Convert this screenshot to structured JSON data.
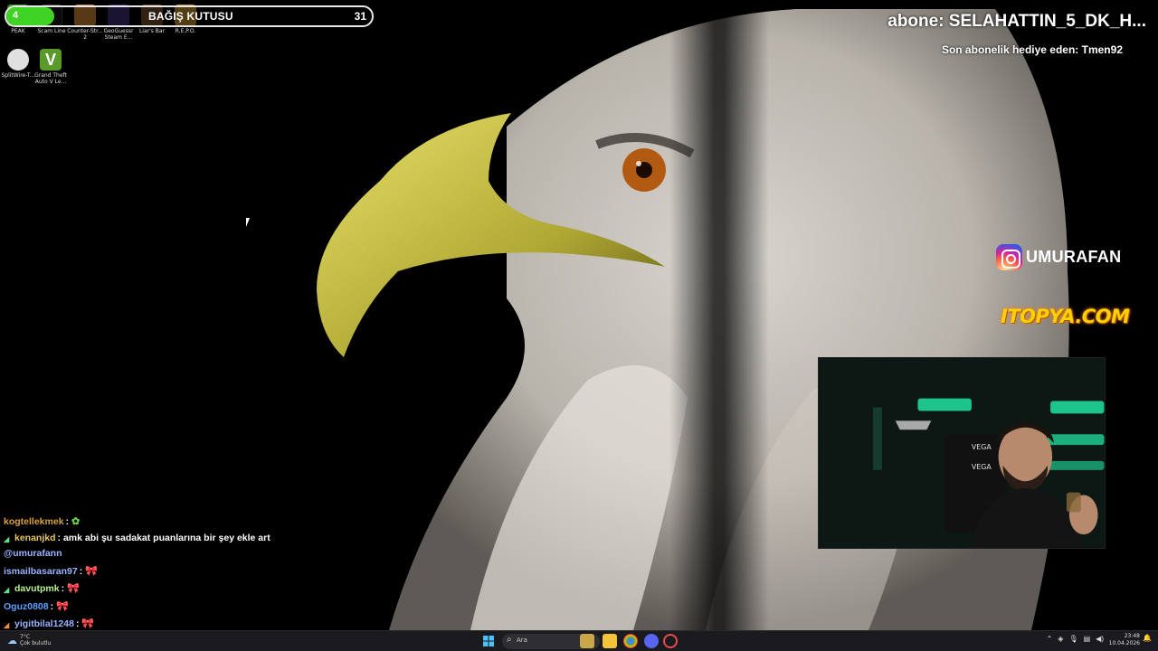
{
  "desktop": {
    "icons": [
      {
        "name": "peak-icon",
        "label": "PEAK",
        "color": "#3c9b2e"
      },
      {
        "name": "scam-line-icon",
        "label": "Scam Line",
        "color": "#1a1a1a"
      },
      {
        "name": "counter-strike-icon",
        "label": "Counter-Str... 2",
        "color": "#c08230"
      },
      {
        "name": "geoguessr-icon",
        "label": "GeoGuessr Steam E...",
        "color": "#3a2e70"
      },
      {
        "name": "liars-bar-icon",
        "label": "Liar's Bar",
        "color": "#6a4a2a"
      },
      {
        "name": "repo-icon",
        "label": "R.E.P.O.",
        "color": "#b88a2a"
      },
      {
        "name": "splitwire-icon",
        "label": "SplitWire-T...",
        "color": "#e0e0e0"
      },
      {
        "name": "gta-v-icon",
        "label": "Grand Theft Auto V Le...",
        "color": "#5a9a2a"
      }
    ]
  },
  "donation": {
    "left_count": "4",
    "title": "BAĞIŞ KUTUSU",
    "count": "31",
    "progress_fraction": 0.13,
    "fill_color": "#3fd423"
  },
  "overlay": {
    "subscriber_ticker": "abone: SELAHATTIN_5_DK_H...",
    "gift_text": "Son abonelik hediye eden: Tmen92",
    "instagram_handle": "UMURAFAN",
    "sponsor": "ITOPYA.COM"
  },
  "chat": {
    "messages": [
      {
        "user": "kogtellekmek",
        "user_color": "#d8a040",
        "text": ": ",
        "emote": "✿"
      },
      {
        "user": "kenanjkd",
        "user_color": "#e5c66a",
        "text": ": amk abi şu sadakat puanlarına bir şey ekle art",
        "emote": ""
      },
      {
        "user": "@umurafann",
        "user_color": "#9ab3ff",
        "text": "",
        "emote": ""
      },
      {
        "user": "ismailbasaran97",
        "user_color": "#9ab3ff",
        "text": ":",
        "emote": "🎀"
      },
      {
        "user": "davutpmk",
        "user_color": "#b6f08a",
        "text": ":",
        "emote": "🎀"
      },
      {
        "user": "Oguz0808",
        "user_color": "#5aa0ff",
        "text": ":",
        "emote": "🎀"
      },
      {
        "user": "yigitbilal1248",
        "user_color": "#9ab3ff",
        "text": ":",
        "emote": "🎀"
      }
    ]
  },
  "taskbar": {
    "weather_temp": "7°C",
    "weather_desc": "Çok bulutlu",
    "search_placeholder": "Ara",
    "time": "23:48",
    "date": "10.04.2026"
  }
}
